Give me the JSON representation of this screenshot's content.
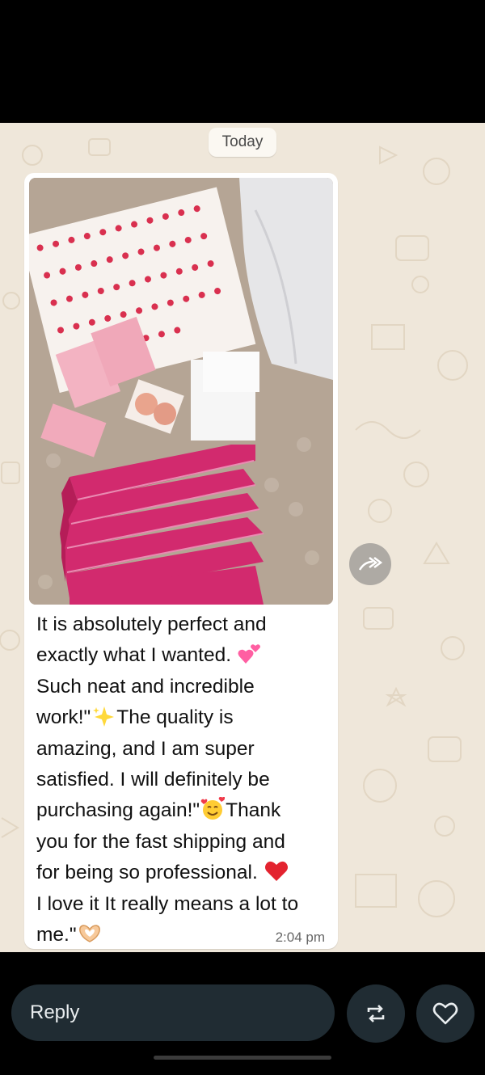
{
  "chat": {
    "date_chip": "Today",
    "message": {
      "lines": [
        {
          "segments": [
            {
              "text": "It is absolutely perfect and"
            }
          ]
        },
        {
          "segments": [
            {
              "text": "exactly what I wanted. "
            },
            {
              "emoji": "two-hearts"
            }
          ]
        },
        {
          "segments": [
            {
              "text": "Such neat and incredible"
            }
          ]
        },
        {
          "segments": [
            {
              "text": "work!\""
            },
            {
              "emoji": "sparkles"
            },
            {
              "text": "The quality is"
            }
          ]
        },
        {
          "segments": [
            {
              "text": "amazing, and I am super"
            }
          ]
        },
        {
          "segments": [
            {
              "text": "satisfied. I will definitely be"
            }
          ]
        },
        {
          "segments": [
            {
              "text": "purchasing again!\""
            },
            {
              "emoji": "smiling-face-with-hearts"
            },
            {
              "text": "Thank"
            }
          ]
        },
        {
          "segments": [
            {
              "text": "you for the fast shipping and"
            }
          ]
        },
        {
          "segments": [
            {
              "text": "for being so professional. "
            },
            {
              "emoji": "red-heart"
            }
          ]
        },
        {
          "segments": [
            {
              "text": "I love it It really means a lot to"
            }
          ]
        },
        {
          "segments": [
            {
              "text": "me.\""
            },
            {
              "emoji": "heart-hands"
            }
          ]
        }
      ],
      "timestamp": "2:04 pm"
    }
  },
  "composer": {
    "reply_label": "Reply",
    "icons": [
      "repost-icon",
      "heart-outline-icon",
      "forward-icon"
    ]
  },
  "colors": {
    "chat_background": "#efe7da",
    "bubble": "#ffffff",
    "bottom_bar": "#000000",
    "input_background": "#202c33"
  }
}
